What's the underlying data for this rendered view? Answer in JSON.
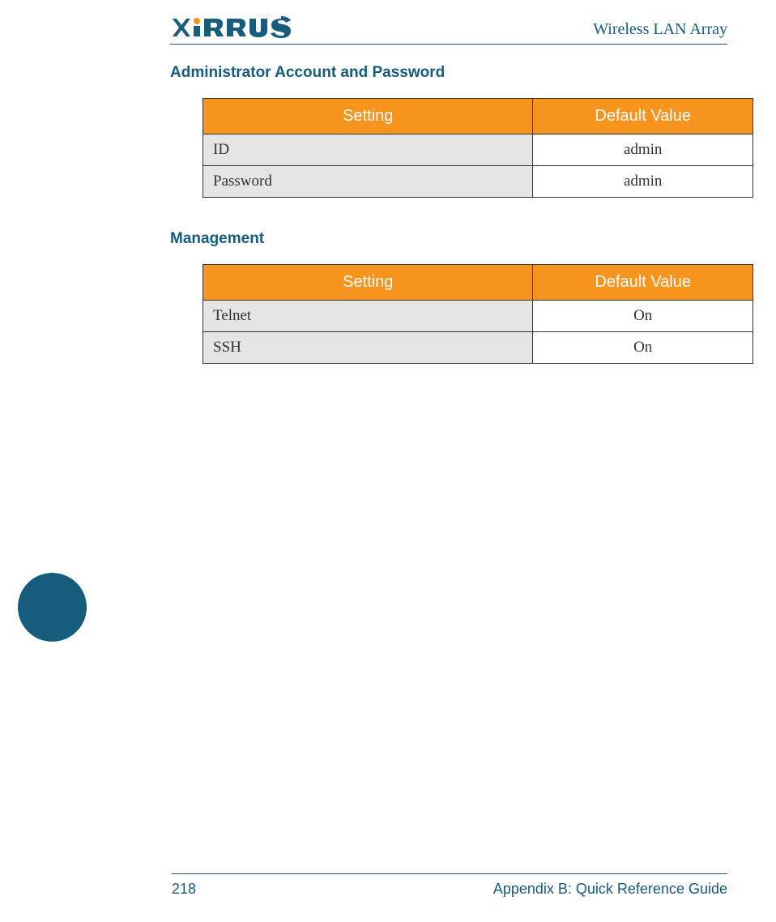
{
  "logo": {
    "brand": "XIRRUS"
  },
  "header": {
    "title": "Wireless LAN Array"
  },
  "sections": {
    "admin": {
      "heading": "Administrator Account and Password",
      "columns": {
        "setting": "Setting",
        "value": "Default Value"
      },
      "rows": [
        {
          "setting": "ID",
          "value": "admin"
        },
        {
          "setting": "Password",
          "value": "admin"
        }
      ]
    },
    "management": {
      "heading": "Management",
      "columns": {
        "setting": "Setting",
        "value": "Default Value"
      },
      "rows": [
        {
          "setting": "Telnet",
          "value": "On"
        },
        {
          "setting": "SSH",
          "value": "On"
        }
      ]
    }
  },
  "footer": {
    "page_number": "218",
    "appendix": "Appendix B: Quick Reference Guide"
  }
}
